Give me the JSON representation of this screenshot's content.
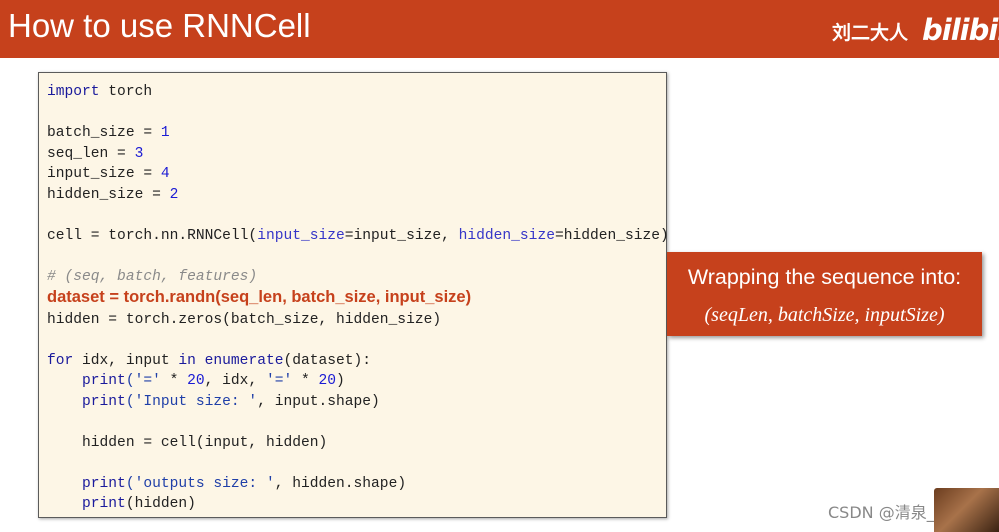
{
  "header": {
    "title": "How to use RNNCell",
    "author": "刘二大人",
    "logo": "bilibili"
  },
  "code": {
    "l1_kw": "import",
    "l1_rest": " torch",
    "l3_name": "batch_size = ",
    "l3_val": "1",
    "l4_name": "seq_len = ",
    "l4_val": "3",
    "l5_name": "input_size = ",
    "l5_val": "4",
    "l6_name": "hidden_size = ",
    "l6_val": "2",
    "l8_a": "cell = torch.nn.RNNCell(",
    "l8_kw1": "input_size",
    "l8_b": "=input_size, ",
    "l8_kw2": "hidden_size",
    "l8_c": "=hidden_size)",
    "l10_comment": "# (seq, batch, features)",
    "l11_highlight": "dataset = torch.randn(seq_len, batch_size, input_size)",
    "l12": "hidden = torch.zeros(batch_size, hidden_size)",
    "l14_for": "for",
    "l14_a": " idx, input ",
    "l14_in": "in",
    "l14_sp": " ",
    "l14_enum": "enumerate",
    "l14_b": "(dataset):",
    "l15_indent": "    ",
    "l15_print": "print",
    "l15_s1": "('='",
    "l15_a": " * ",
    "l15_n1": "20",
    "l15_b": ", idx, ",
    "l15_s2": "'='",
    "l15_c": " * ",
    "l15_n2": "20",
    "l15_d": ")",
    "l16_indent": "    ",
    "l16_print": "print",
    "l16_s": "('Input size: '",
    "l16_rest": ", input.shape)",
    "l18": "    hidden = cell(input, hidden)",
    "l20_indent": "    ",
    "l20_print": "print",
    "l20_s": "('outputs size: '",
    "l20_rest": ", hidden.shape)",
    "l21_indent": "    ",
    "l21_print": "print",
    "l21_rest": "(hidden)"
  },
  "callout": {
    "text": "Wrapping the sequence into:",
    "formula": "(seqLen, batchSize, inputSize)"
  },
  "watermark": "CSDN @清泉_流响",
  "colors": {
    "accent": "#c6411c",
    "code_background": "#fdf6e6",
    "keyword": "#1a1a9c",
    "number": "#1b1bd4"
  }
}
